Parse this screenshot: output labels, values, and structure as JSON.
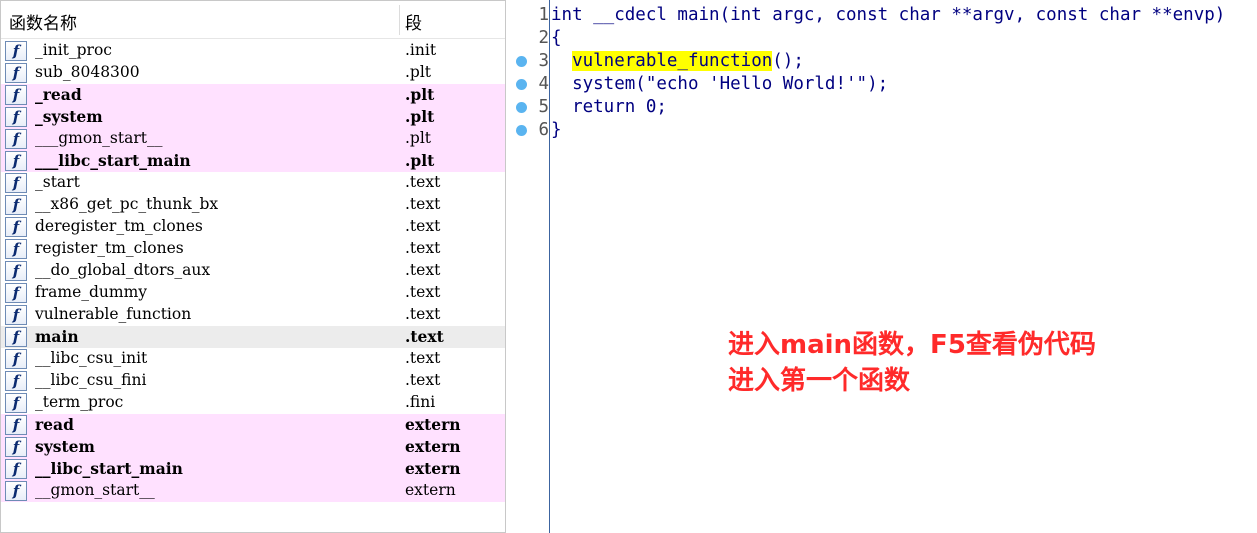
{
  "function_list": {
    "header": {
      "name_col": "函数名称",
      "segment_col": "段"
    },
    "icon_glyph": "f",
    "rows": [
      {
        "name": "_init_proc",
        "segment": ".init",
        "style": "normal"
      },
      {
        "name": "sub_8048300",
        "segment": ".plt",
        "style": "normal"
      },
      {
        "name": "_read",
        "segment": ".plt",
        "style": "import-bold"
      },
      {
        "name": "_system",
        "segment": ".plt",
        "style": "import-bold"
      },
      {
        "name": "___gmon_start__",
        "segment": ".plt",
        "style": "import"
      },
      {
        "name": "___libc_start_main",
        "segment": ".plt",
        "style": "import-bold"
      },
      {
        "name": "_start",
        "segment": ".text",
        "style": "normal"
      },
      {
        "name": "__x86_get_pc_thunk_bx",
        "segment": ".text",
        "style": "normal"
      },
      {
        "name": "deregister_tm_clones",
        "segment": ".text",
        "style": "normal"
      },
      {
        "name": "register_tm_clones",
        "segment": ".text",
        "style": "normal"
      },
      {
        "name": "__do_global_dtors_aux",
        "segment": ".text",
        "style": "normal"
      },
      {
        "name": "frame_dummy",
        "segment": ".text",
        "style": "normal"
      },
      {
        "name": "vulnerable_function",
        "segment": ".text",
        "style": "normal"
      },
      {
        "name": "main",
        "segment": ".text",
        "style": "selected"
      },
      {
        "name": "__libc_csu_init",
        "segment": ".text",
        "style": "normal"
      },
      {
        "name": "__libc_csu_fini",
        "segment": ".text",
        "style": "normal"
      },
      {
        "name": "_term_proc",
        "segment": ".fini",
        "style": "normal"
      },
      {
        "name": "read",
        "segment": "extern",
        "style": "import-bold"
      },
      {
        "name": "system",
        "segment": "extern",
        "style": "import-bold"
      },
      {
        "name": "__libc_start_main",
        "segment": "extern",
        "style": "import-bold"
      },
      {
        "name": "__gmon_start__",
        "segment": "extern",
        "style": "import"
      }
    ]
  },
  "pseudocode": {
    "lines": [
      {
        "num": "1",
        "breakpoint": false,
        "pre": "int __cdecl main(int argc, const char **argv, const char **envp)",
        "hl": "",
        "post": ""
      },
      {
        "num": "2",
        "breakpoint": false,
        "pre": "{",
        "hl": "",
        "post": ""
      },
      {
        "num": "3",
        "breakpoint": true,
        "pre": "  ",
        "hl": "vulnerable_function",
        "post": "();"
      },
      {
        "num": "4",
        "breakpoint": true,
        "pre": "  system(\"echo 'Hello World!'\");",
        "hl": "",
        "post": ""
      },
      {
        "num": "5",
        "breakpoint": true,
        "pre": "  return 0;",
        "hl": "",
        "post": ""
      },
      {
        "num": "6",
        "breakpoint": true,
        "pre": "}",
        "hl": "",
        "post": ""
      }
    ]
  },
  "annotation": {
    "line1": "进入main函数，F5查看伪代码",
    "line2": "进入第一个函数"
  },
  "colors": {
    "import_row_bg": "#ffe1ff",
    "selected_row_bg": "#ececec",
    "highlight": "#ffff00",
    "annotation": "#ff2a2a",
    "code_text": "#000080",
    "breakpoint": "#5ab4f0"
  }
}
